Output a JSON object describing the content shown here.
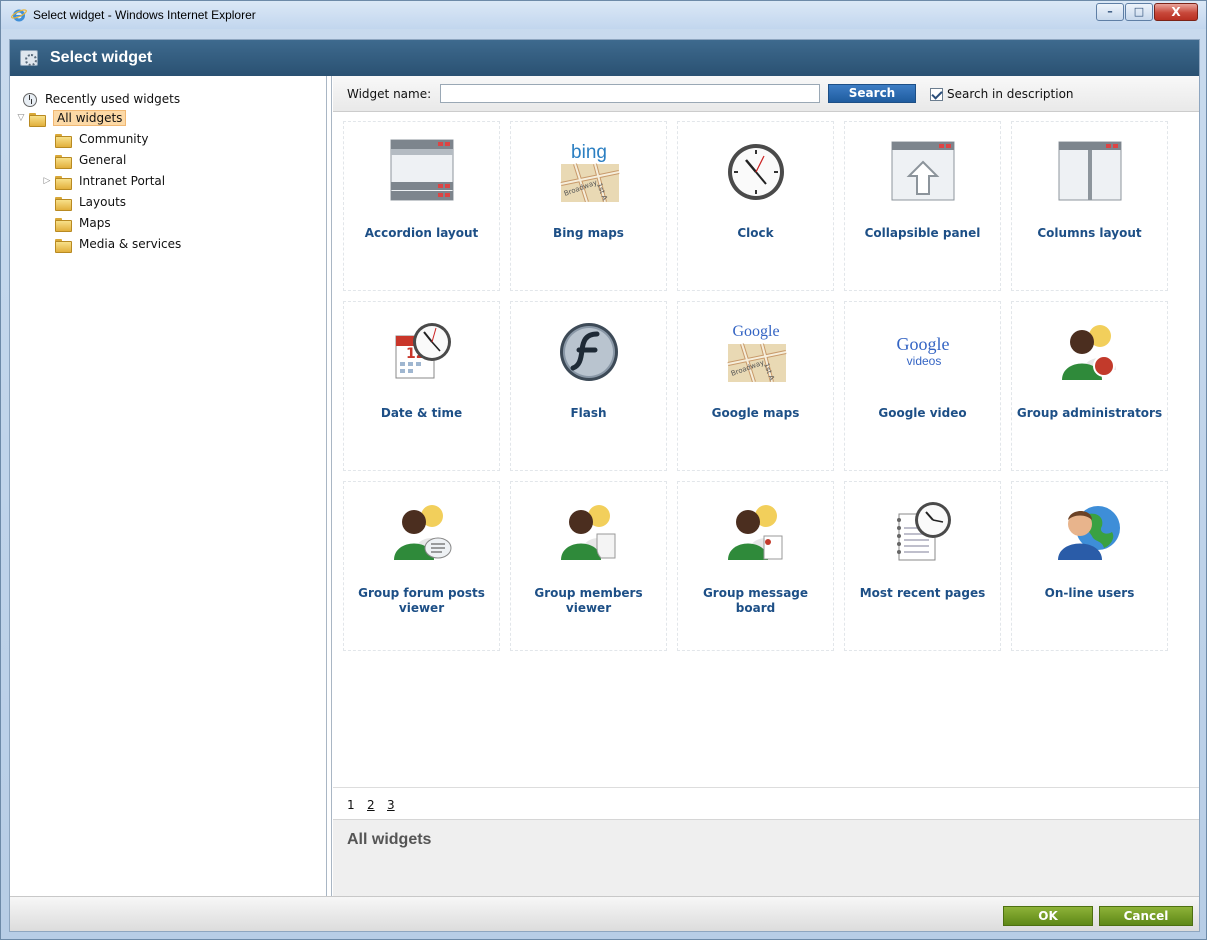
{
  "window": {
    "title": "Select widget - Windows Internet Explorer",
    "buttons": {
      "minimize": "–",
      "maximize": "□",
      "close": "X"
    }
  },
  "dialog": {
    "title": "Select widget"
  },
  "tree": {
    "recent": "Recently used widgets",
    "root": "All widgets",
    "children": [
      "Community",
      "General",
      "Intranet Portal",
      "Layouts",
      "Maps",
      "Media & services"
    ]
  },
  "search": {
    "label": "Widget name:",
    "value": "",
    "button": "Search",
    "checkbox_label": "Search in description",
    "checkbox_checked": true
  },
  "widgets": [
    {
      "name": "Accordion layout",
      "icon": "accordion-layout-icon"
    },
    {
      "name": "Bing maps",
      "icon": "bing-maps-icon"
    },
    {
      "name": "Clock",
      "icon": "clock-icon"
    },
    {
      "name": "Collapsible panel",
      "icon": "collapsible-panel-icon"
    },
    {
      "name": "Columns layout",
      "icon": "columns-layout-icon"
    },
    {
      "name": "Date & time",
      "icon": "date-time-icon"
    },
    {
      "name": "Flash",
      "icon": "flash-icon"
    },
    {
      "name": "Google maps",
      "icon": "google-maps-icon"
    },
    {
      "name": "Google video",
      "icon": "google-video-icon"
    },
    {
      "name": "Group administrators",
      "icon": "group-administrators-icon"
    },
    {
      "name": "Group forum posts viewer",
      "icon": "group-forum-posts-icon"
    },
    {
      "name": "Group members viewer",
      "icon": "group-members-icon"
    },
    {
      "name": "Group message board",
      "icon": "group-message-board-icon"
    },
    {
      "name": "Most recent pages",
      "icon": "most-recent-pages-icon"
    },
    {
      "name": "On-line users",
      "icon": "online-users-icon"
    }
  ],
  "icon_text": {
    "bing": "bing",
    "google": "Google",
    "videos": "videos",
    "map1": "Broadway",
    "map2": "1st A",
    "cal": "12"
  },
  "pager": {
    "pages": [
      "1",
      "2",
      "3"
    ],
    "current": "1"
  },
  "description": {
    "title": "All widgets"
  },
  "footer": {
    "ok": "OK",
    "cancel": "Cancel"
  },
  "colors": {
    "header": "#2f5778",
    "link": "#1d4f86",
    "accent_button": "#2a69b0",
    "ok_green": "#76a02a"
  }
}
